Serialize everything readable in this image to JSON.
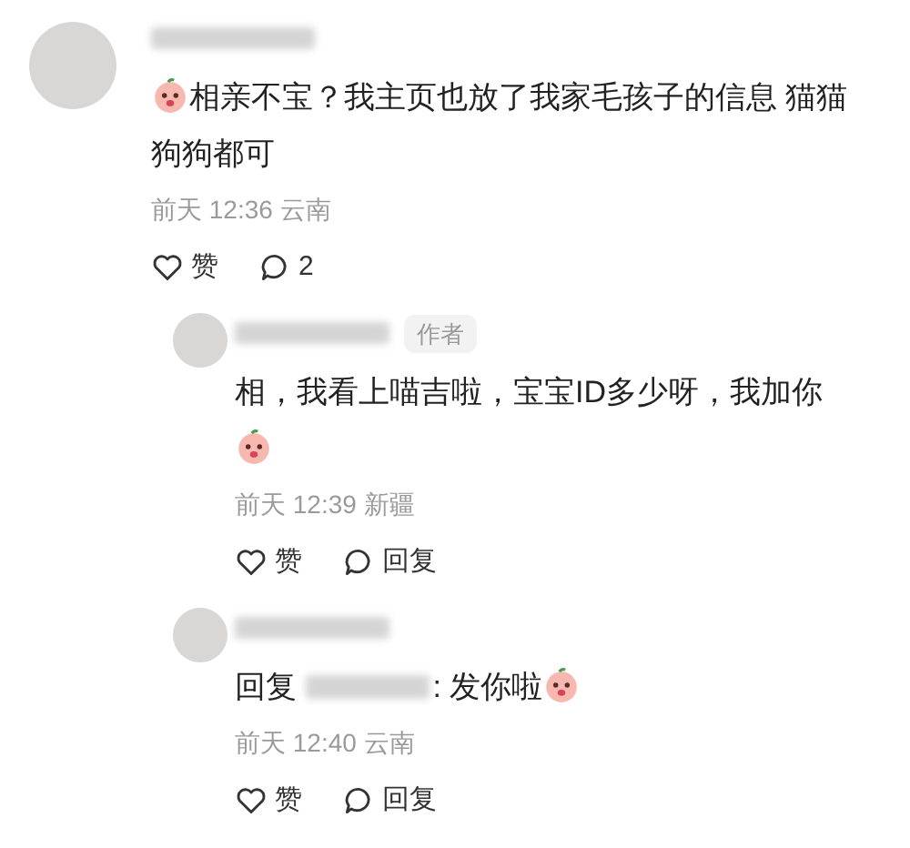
{
  "comments": [
    {
      "segments": [
        {
          "kind": "sticker"
        },
        {
          "kind": "text",
          "text": "相亲不宝？我主页也放了我家毛孩子的信息 猫猫狗狗都可"
        }
      ],
      "time": "前天 12:36 云南",
      "actions": [
        {
          "kind": "like",
          "label": "赞"
        },
        {
          "kind": "reply",
          "label": "2"
        }
      ],
      "replies": [
        {
          "badge": "作者",
          "segments": [
            {
              "kind": "text",
              "text": "相，我看上喵吉啦，宝宝ID多少呀，我加你"
            },
            {
              "kind": "break"
            },
            {
              "kind": "sticker"
            }
          ],
          "time": "前天 12:39 新疆",
          "actions": [
            {
              "kind": "like",
              "label": "赞"
            },
            {
              "kind": "reply",
              "label": "回复"
            }
          ]
        },
        {
          "segments": [
            {
              "kind": "text",
              "text": "回复 "
            },
            {
              "kind": "redacted"
            },
            {
              "kind": "text",
              "text": ": 发你啦"
            },
            {
              "kind": "sticker"
            }
          ],
          "time": "前天 12:40 云南",
          "actions": [
            {
              "kind": "like",
              "label": "赞"
            },
            {
              "kind": "reply",
              "label": "回复"
            }
          ]
        }
      ]
    }
  ]
}
